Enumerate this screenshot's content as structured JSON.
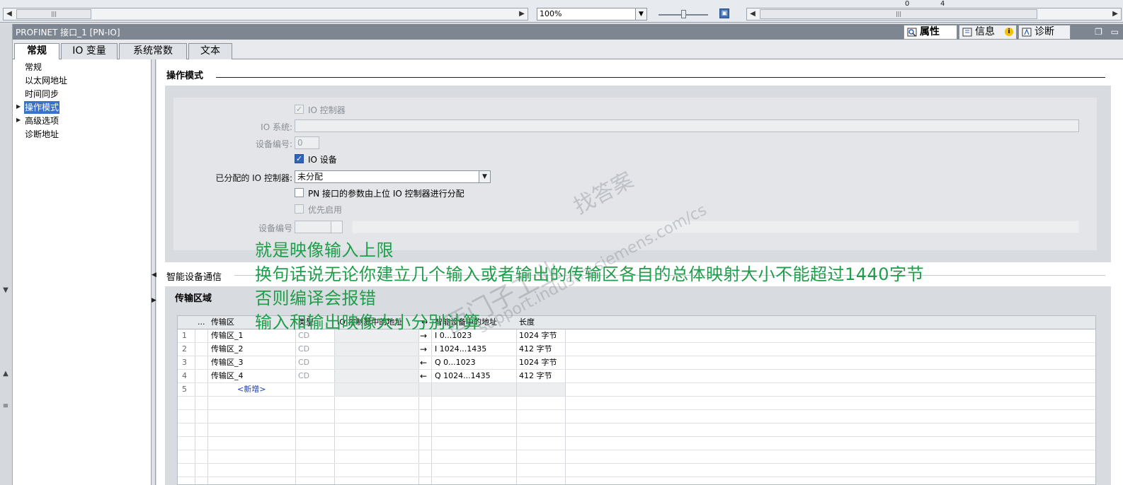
{
  "top": {
    "zoom_value": "100%",
    "nums": [
      "0",
      "4"
    ]
  },
  "header": {
    "title": "PROFINET 接口_1 [PN-IO]",
    "tabs": [
      {
        "label": "属性",
        "icon": "properties-icon"
      },
      {
        "label": "信息",
        "icon": "info-icon"
      },
      {
        "label": "诊断",
        "icon": "diagnostics-icon"
      }
    ]
  },
  "tabs": [
    "常规",
    "IO 变量",
    "系统常数",
    "文本"
  ],
  "nav": {
    "items": [
      "常规",
      "以太网地址",
      "时间同步",
      "操作模式",
      "高级选项",
      "诊断地址"
    ],
    "selected": "操作模式"
  },
  "opmode": {
    "title": "操作模式",
    "io_controller_label": "IO 控制器",
    "io_system_label": "IO 系统:",
    "device_number_label": "设备编号:",
    "device_number_value": "0",
    "io_device_label": "IO 设备",
    "assigned_controller_label": "已分配的 IO 控制器:",
    "assigned_controller_value": "未分配",
    "pn_param_label": "PN 接口的参数由上位 IO 控制器进行分配",
    "priority_label": "优先启用",
    "device_number2_label": "设备编号"
  },
  "isource": {
    "title": "智能设备通信",
    "transfer_title": "传输区域",
    "columns": [
      "...",
      "传输区",
      "类型",
      "IO 控制器中的地址",
      "↔",
      "智能设备中的地址",
      "长度"
    ],
    "rows": [
      {
        "num": "1",
        "name": "传输区_1",
        "type": "CD",
        "dir": "→",
        "addr": "I 0...1023",
        "len": "1024 字节"
      },
      {
        "num": "2",
        "name": "传输区_2",
        "type": "CD",
        "dir": "→",
        "addr": "I 1024...1435",
        "len": "412 字节"
      },
      {
        "num": "3",
        "name": "传输区_3",
        "type": "CD",
        "dir": "←",
        "addr": "Q 0...1023",
        "len": "1024 字节"
      },
      {
        "num": "4",
        "name": "传输区_4",
        "type": "CD",
        "dir": "←",
        "addr": "Q 1024...1435",
        "len": "412 字节"
      }
    ],
    "add_row": {
      "num": "5",
      "label": "<新增>"
    }
  },
  "annotations": [
    "就是映像输入上限",
    "换句话说无论你建立几个输入或者输出的传输区各自的总体映射大小不能超过1440字节",
    "否则编译会报错",
    "输入和输出映像大小分别计算"
  ],
  "watermark": [
    "西门子工业",
    "找答案",
    "support.industry.siemens.com/cs"
  ],
  "colors": {
    "accent": "#3a71c9",
    "annotation": "#1f9e4a",
    "header": "#7d8691"
  }
}
